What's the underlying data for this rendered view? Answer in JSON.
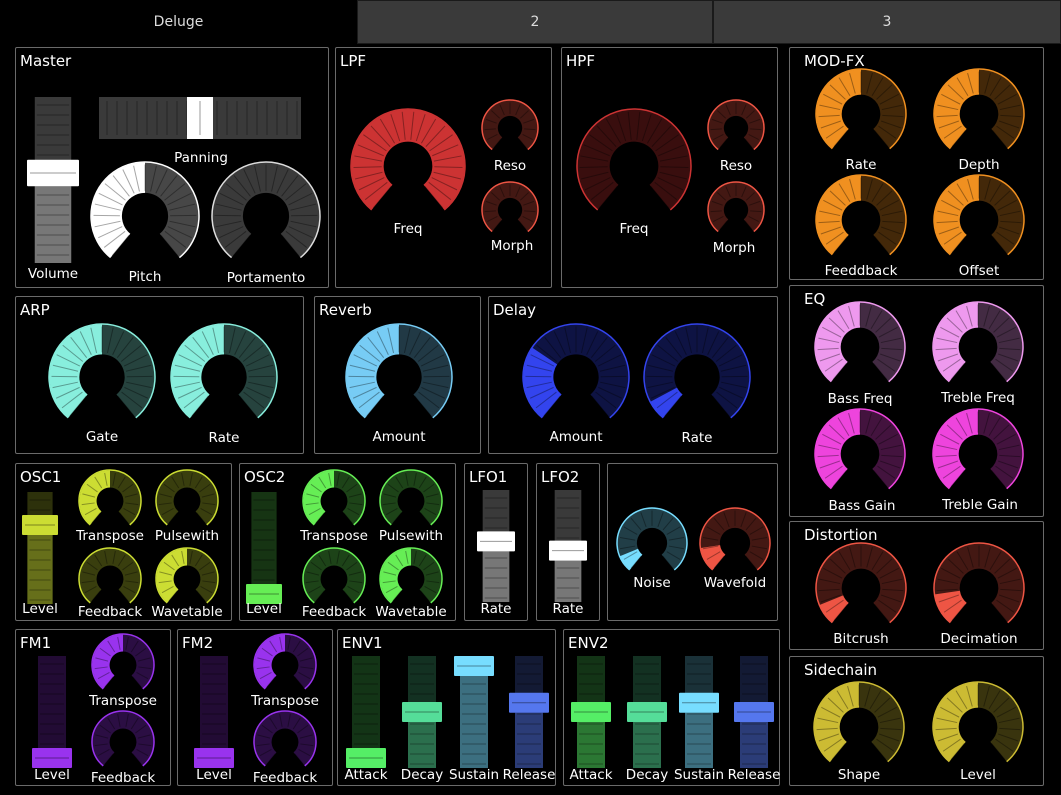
{
  "tabs": [
    {
      "label": "Deluge",
      "active": true
    },
    {
      "label": "2"
    },
    {
      "label": "3"
    }
  ],
  "master": {
    "title": "Master",
    "volume": {
      "label": "Volume",
      "value": 0.55
    },
    "panning": {
      "label": "Panning",
      "value": 0.5
    },
    "pitch": {
      "label": "Pitch",
      "value": 0.5
    },
    "portamento": {
      "label": "Portamento",
      "value": 0.0
    }
  },
  "lpf": {
    "title": "LPF",
    "freq": {
      "label": "Freq",
      "value": 1.0
    },
    "reso": {
      "label": "Reso",
      "value": 0.0
    },
    "morph": {
      "label": "Morph",
      "value": 0.0
    }
  },
  "hpf": {
    "title": "HPF",
    "freq": {
      "label": "Freq",
      "value": 0.0
    },
    "reso": {
      "label": "Reso",
      "value": 0.0
    },
    "morph": {
      "label": "Morph",
      "value": 0.0
    }
  },
  "modfx": {
    "title": "MOD-FX",
    "rate": {
      "label": "Rate",
      "value": 0.5
    },
    "depth": {
      "label": "Depth",
      "value": 0.5
    },
    "feedback": {
      "label": "Feeddback",
      "value": 0.5
    },
    "offset": {
      "label": "Offset",
      "value": 0.5
    }
  },
  "arp": {
    "title": "ARP",
    "gate": {
      "label": "Gate",
      "value": 0.5
    },
    "rate": {
      "label": "Rate",
      "value": 0.5
    }
  },
  "reverb": {
    "title": "Reverb",
    "amount": {
      "label": "Amount",
      "value": 0.5
    }
  },
  "delay": {
    "title": "Delay",
    "amount": {
      "label": "Amount",
      "value": 0.3
    },
    "rate": {
      "label": "Rate",
      "value": 0.08
    }
  },
  "eq": {
    "title": "EQ",
    "bass_freq": {
      "label": "Bass Freq",
      "value": 0.5
    },
    "treble_freq": {
      "label": "Treble Freq",
      "value": 0.5
    },
    "bass_gain": {
      "label": "Bass Gain",
      "value": 0.5
    },
    "treble_gain": {
      "label": "Treble Gain",
      "value": 0.5
    }
  },
  "osc1": {
    "title": "OSC1",
    "level": {
      "label": "Level",
      "value": 0.75
    },
    "transpose": {
      "label": "Transpose",
      "value": 0.5
    },
    "pulsewidth": {
      "label": "Pulsewith",
      "value": 0.0
    },
    "feedback": {
      "label": "Feedback",
      "value": 0.0
    },
    "wavetable": {
      "label": "Wavetable",
      "value": 0.5
    }
  },
  "osc2": {
    "title": "OSC2",
    "level": {
      "label": "Level",
      "value": 0.0
    },
    "transpose": {
      "label": "Transpose",
      "value": 0.5
    },
    "pulsewidth": {
      "label": "Pulsewith",
      "value": 0.0
    },
    "feedback": {
      "label": "Feedback",
      "value": 0.0
    },
    "wavetable": {
      "label": "Wavetable",
      "value": 0.5
    }
  },
  "lfo1": {
    "title": "LFO1",
    "rate": {
      "label": "Rate",
      "value": 0.55
    }
  },
  "lfo2": {
    "title": "LFO2",
    "rate": {
      "label": "Rate",
      "value": 0.45
    }
  },
  "noise": {
    "noise": {
      "label": "Noise",
      "value": 0.1
    },
    "wavefold": {
      "label": "Wavefold",
      "value": 0.15
    }
  },
  "distortion": {
    "title": "Distortion",
    "bitcrush": {
      "label": "Bitcrush",
      "value": 0.1
    },
    "decimation": {
      "label": "Decimation",
      "value": 0.15
    }
  },
  "fm1": {
    "title": "FM1",
    "level": {
      "label": "Level",
      "value": 0.0
    },
    "transpose": {
      "label": "Transpose",
      "value": 0.5
    },
    "feedback": {
      "label": "Feedback",
      "value": 0.0
    }
  },
  "fm2": {
    "title": "FM2",
    "level": {
      "label": "Level",
      "value": 0.0
    },
    "transpose": {
      "label": "Transpose",
      "value": 0.5
    },
    "feedback": {
      "label": "Feedback",
      "value": 0.0
    }
  },
  "env1": {
    "title": "ENV1",
    "attack": {
      "label": "Attack",
      "value": 0.0
    },
    "decay": {
      "label": "Decay",
      "value": 0.5
    },
    "sustain": {
      "label": "Sustain",
      "value": 1.0
    },
    "release": {
      "label": "Release",
      "value": 0.6
    }
  },
  "env2": {
    "title": "ENV2",
    "attack": {
      "label": "Attack",
      "value": 0.5
    },
    "decay": {
      "label": "Decay",
      "value": 0.5
    },
    "sustain": {
      "label": "Sustain",
      "value": 0.6
    },
    "release": {
      "label": "Release",
      "value": 0.5
    }
  },
  "sidechain": {
    "title": "Sidechain",
    "shape": {
      "label": "Shape",
      "value": 0.5
    },
    "level": {
      "label": "Level",
      "value": 0.5
    }
  },
  "colors": {
    "gray": "#ffffff",
    "red": "#cc3333",
    "orange": "#f09020",
    "pink": "#ee99ee",
    "magenta": "#ee44dd",
    "cyan": "#88eedd",
    "skyblue": "#77ccf5",
    "blue": "#3344ee",
    "olive": "#ccdd33",
    "green": "#66ee55",
    "purple": "#9933ee",
    "orangered": "#ee5544",
    "yellow": "#ccbb33",
    "lightgreen": "#55ee66",
    "mint": "#55dd99",
    "teal": "#77ddff",
    "slateblue": "#5577ee"
  }
}
